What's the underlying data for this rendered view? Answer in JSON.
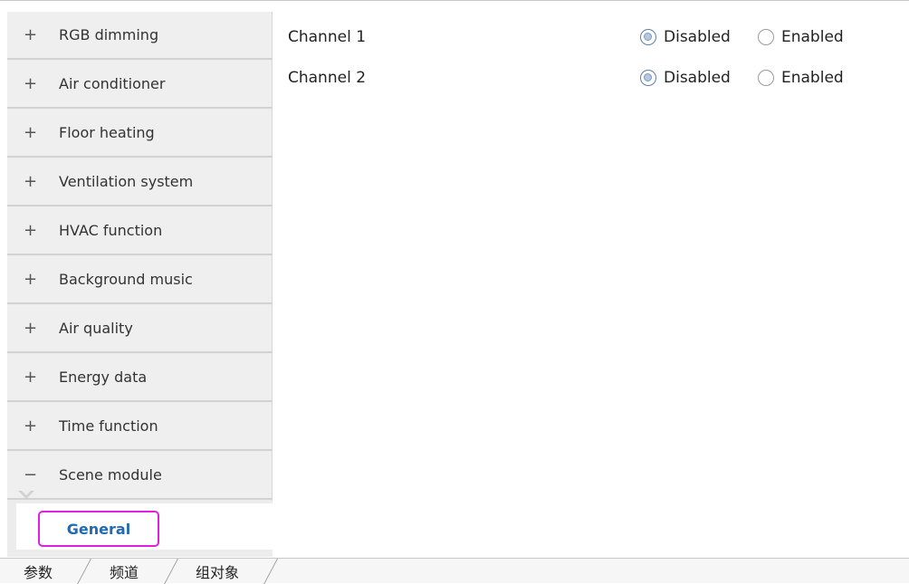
{
  "sidebar": {
    "items": [
      {
        "sign": "+",
        "label": "RGB dimming"
      },
      {
        "sign": "+",
        "label": "Air conditioner"
      },
      {
        "sign": "+",
        "label": "Floor heating"
      },
      {
        "sign": "+",
        "label": "Ventilation system"
      },
      {
        "sign": "+",
        "label": "HVAC function"
      },
      {
        "sign": "+",
        "label": "Background music"
      },
      {
        "sign": "+",
        "label": "Air quality"
      },
      {
        "sign": "+",
        "label": "Energy data"
      },
      {
        "sign": "+",
        "label": "Time function"
      },
      {
        "sign": "−",
        "label": "Scene module"
      }
    ],
    "sub_item": {
      "label": "General",
      "highlight_color": "#e020e0"
    }
  },
  "main": {
    "rows": [
      {
        "label": "Channel 1",
        "options": [
          {
            "label": "Disabled",
            "selected": true
          },
          {
            "label": "Enabled",
            "selected": false
          }
        ]
      },
      {
        "label": "Channel 2",
        "options": [
          {
            "label": "Disabled",
            "selected": true
          },
          {
            "label": "Enabled",
            "selected": false
          }
        ]
      }
    ]
  },
  "tabs": [
    {
      "label": "参数",
      "active": true
    },
    {
      "label": "频道",
      "active": false
    },
    {
      "label": "组对象",
      "active": false
    }
  ],
  "colors": {
    "accent": "#1f6ab0",
    "sidebar_bg": "#efefef"
  }
}
